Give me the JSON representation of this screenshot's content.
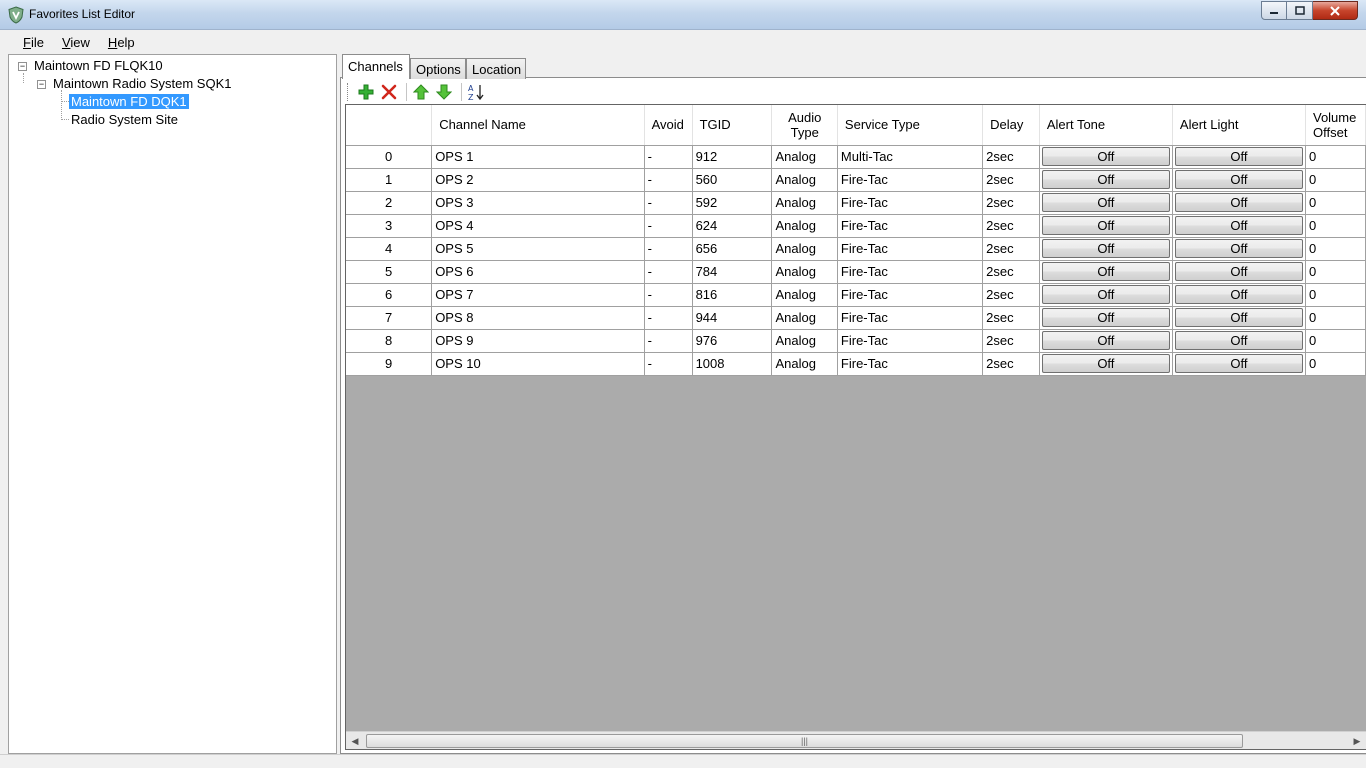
{
  "window": {
    "title": "Favorites List Editor",
    "icon": "shield-app-icon"
  },
  "menu": [
    {
      "label_pre": "",
      "accel": "F",
      "label_post": "ile"
    },
    {
      "label_pre": "",
      "accel": "V",
      "label_post": "iew"
    },
    {
      "label_pre": "",
      "accel": "H",
      "label_post": "elp"
    }
  ],
  "tree": {
    "root": "Maintown FD FLQK10",
    "system": "Maintown Radio System SQK1",
    "group_selected": "Maintown FD DQK1",
    "site": "Radio System Site"
  },
  "tabs": [
    "Channels",
    "Options",
    "Location"
  ],
  "active_tab": "Channels",
  "toolbar_icons": [
    "add-icon",
    "delete-icon",
    "move-up-icon",
    "move-down-icon",
    "sort-az-icon"
  ],
  "grid": {
    "columns": [
      {
        "label": ""
      },
      {
        "label": "Channel Name"
      },
      {
        "label": "Avoid"
      },
      {
        "label": "TGID"
      },
      {
        "label": "Audio Type"
      },
      {
        "label": "Service Type"
      },
      {
        "label": "Delay"
      },
      {
        "label": "Alert Tone"
      },
      {
        "label": "Alert Light"
      },
      {
        "label": "Volume Offset"
      }
    ],
    "rows": [
      {
        "index": "0",
        "name": "OPS 1",
        "avoid": "-",
        "tgid": "912",
        "audio": "Analog",
        "service": "Multi-Tac",
        "delay": "2sec",
        "alert_tone": "Off",
        "alert_light": "Off",
        "volume": "0"
      },
      {
        "index": "1",
        "name": "OPS 2",
        "avoid": "-",
        "tgid": "560",
        "audio": "Analog",
        "service": "Fire-Tac",
        "delay": "2sec",
        "alert_tone": "Off",
        "alert_light": "Off",
        "volume": "0"
      },
      {
        "index": "2",
        "name": "OPS 3",
        "avoid": "-",
        "tgid": "592",
        "audio": "Analog",
        "service": "Fire-Tac",
        "delay": "2sec",
        "alert_tone": "Off",
        "alert_light": "Off",
        "volume": "0"
      },
      {
        "index": "3",
        "name": "OPS 4",
        "avoid": "-",
        "tgid": "624",
        "audio": "Analog",
        "service": "Fire-Tac",
        "delay": "2sec",
        "alert_tone": "Off",
        "alert_light": "Off",
        "volume": "0"
      },
      {
        "index": "4",
        "name": "OPS 5",
        "avoid": "-",
        "tgid": "656",
        "audio": "Analog",
        "service": "Fire-Tac",
        "delay": "2sec",
        "alert_tone": "Off",
        "alert_light": "Off",
        "volume": "0"
      },
      {
        "index": "5",
        "name": "OPS 6",
        "avoid": "-",
        "tgid": "784",
        "audio": "Analog",
        "service": "Fire-Tac",
        "delay": "2sec",
        "alert_tone": "Off",
        "alert_light": "Off",
        "volume": "0"
      },
      {
        "index": "6",
        "name": "OPS 7",
        "avoid": "-",
        "tgid": "816",
        "audio": "Analog",
        "service": "Fire-Tac",
        "delay": "2sec",
        "alert_tone": "Off",
        "alert_light": "Off",
        "volume": "0"
      },
      {
        "index": "7",
        "name": "OPS 8",
        "avoid": "-",
        "tgid": "944",
        "audio": "Analog",
        "service": "Fire-Tac",
        "delay": "2sec",
        "alert_tone": "Off",
        "alert_light": "Off",
        "volume": "0"
      },
      {
        "index": "8",
        "name": "OPS 9",
        "avoid": "-",
        "tgid": "976",
        "audio": "Analog",
        "service": "Fire-Tac",
        "delay": "2sec",
        "alert_tone": "Off",
        "alert_light": "Off",
        "volume": "0"
      },
      {
        "index": "9",
        "name": "OPS 10",
        "avoid": "-",
        "tgid": "1008",
        "audio": "Analog",
        "service": "Fire-Tac",
        "delay": "2sec",
        "alert_tone": "Off",
        "alert_light": "Off",
        "volume": "0"
      }
    ]
  },
  "colors": {
    "selection": "#3399ff",
    "grid_background": "#ababab",
    "add_green": "#2fa82f",
    "delete_red": "#d0261b"
  }
}
